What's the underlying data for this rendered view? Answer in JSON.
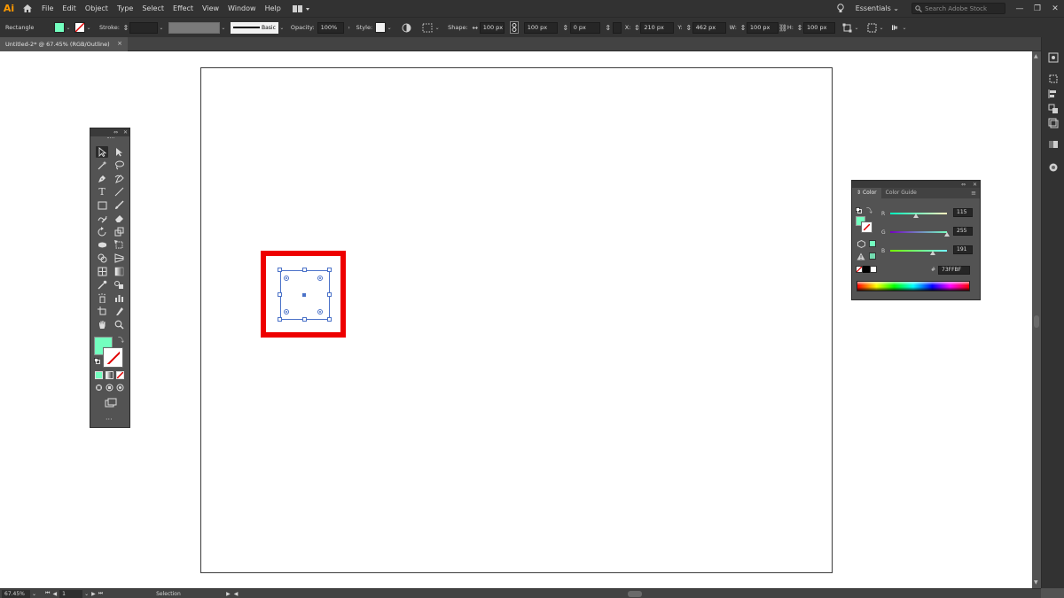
{
  "app": {
    "logo": "Ai"
  },
  "menu": [
    "File",
    "Edit",
    "Object",
    "Type",
    "Select",
    "Effect",
    "View",
    "Window",
    "Help"
  ],
  "workspace": {
    "label": "Essentials",
    "search_placeholder": "Search Adobe Stock"
  },
  "control_bar": {
    "object_type": "Rectangle",
    "fill_color": "#73ffbf",
    "stroke_label": "Stroke:",
    "stroke_profile": "Basic",
    "opacity_label": "Opacity:",
    "opacity_value": "100%",
    "style_label": "Style:",
    "shape_label": "Shape:",
    "shape_width": "100 px",
    "shape_height": "100 px",
    "corner_radius": "0 px",
    "x_label": "X:",
    "x_value": "210 px",
    "y_label": "Y:",
    "y_value": "462 px",
    "w_label": "W:",
    "w_value": "100 px",
    "h_label": "H:",
    "h_value": "100 px"
  },
  "document_tab": {
    "title": "Untitled-2* @ 67.45% (RGB/Outline)",
    "close": "×"
  },
  "color_panel": {
    "tabs": [
      "Color",
      "Color Guide"
    ],
    "channels": [
      {
        "label": "R",
        "value": "115",
        "fraction": 0.451
      },
      {
        "label": "G",
        "value": "255",
        "fraction": 1.0
      },
      {
        "label": "B",
        "value": "191",
        "fraction": 0.749
      }
    ],
    "hex_label": "#",
    "hex_value": "73FFBF",
    "fill_color": "#73ffbf"
  },
  "status_bar": {
    "zoom": "67.45%",
    "artboard_number": "1",
    "tool": "Selection"
  },
  "colors": {
    "highlight": "#ee0000",
    "selection": "#4b72c8",
    "accent_logo": "#ff9a00"
  }
}
